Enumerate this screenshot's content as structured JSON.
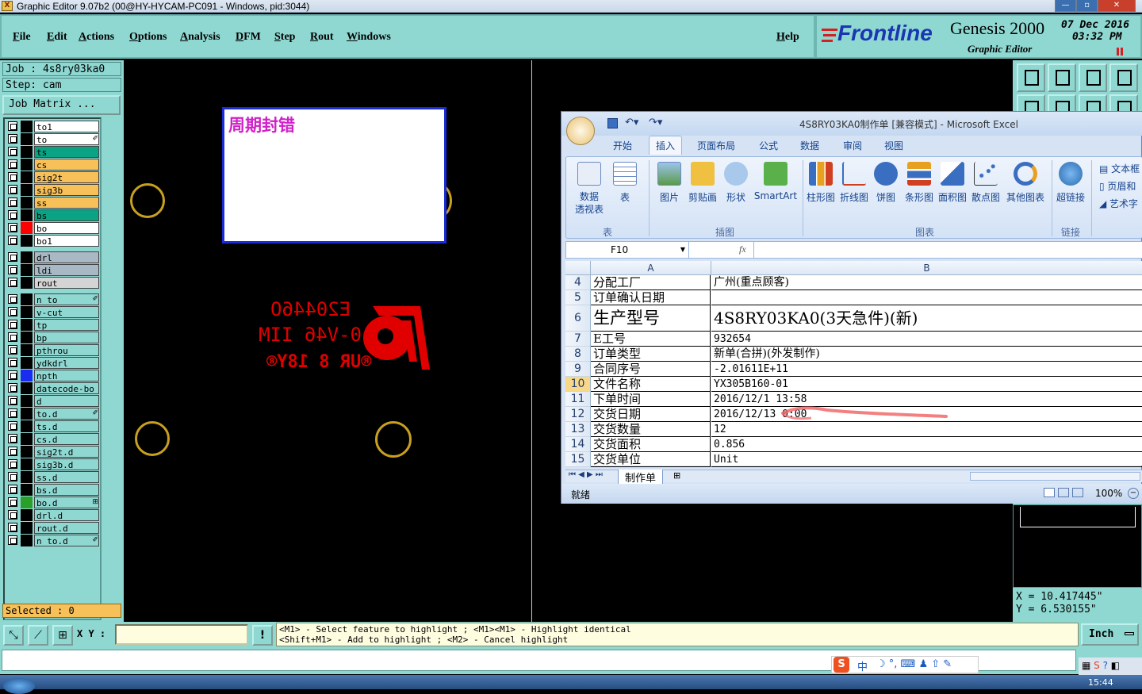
{
  "window": {
    "title": "Graphic Editor 9.07b2 (00@HY-HYCAM-PC091 - Windows, pid:3044)",
    "app_icon_glyph": "X"
  },
  "menu": {
    "items": [
      "File",
      "Edit",
      "Actions",
      "Options",
      "Analysis",
      "DFM",
      "Step",
      "Rout",
      "Windows"
    ],
    "help": "Help"
  },
  "branding": {
    "logo": "Frontline",
    "product": "Genesis 2000",
    "subtitle": "Graphic Editor",
    "date": "07 Dec 2016",
    "time": "03:32 PM"
  },
  "job": {
    "job_label": "Job : 4s8ry03ka0",
    "step_label": "Step: cam",
    "matrix_button": "Job Matrix ..."
  },
  "layers": [
    {
      "name": "to1",
      "bg": "#ffffff",
      "color": "#000000",
      "mark": ""
    },
    {
      "name": "to",
      "bg": "#ffffff",
      "color": "#000000",
      "mark": "✐"
    },
    {
      "name": "ts",
      "bg": "#0aa383",
      "color": "#000000",
      "mark": ""
    },
    {
      "name": "cs",
      "bg": "#f8c058",
      "color": "#000000",
      "mark": ""
    },
    {
      "name": "sig2t",
      "bg": "#f8c058",
      "color": "#000000",
      "mark": ""
    },
    {
      "name": "sig3b",
      "bg": "#f8c058",
      "color": "#000000",
      "mark": ""
    },
    {
      "name": "ss",
      "bg": "#f8c058",
      "color": "#000000",
      "mark": ""
    },
    {
      "name": "bs",
      "bg": "#0aa383",
      "color": "#000000",
      "mark": ""
    },
    {
      "name": "bo",
      "bg": "#ffffff",
      "color": "#ff0000",
      "mark": ""
    },
    {
      "name": "bo1",
      "bg": "#ffffff",
      "color": "#000000",
      "mark": ""
    },
    {
      "name": "drl",
      "bg": "#a8b8c4",
      "color": "#000000",
      "mark": ""
    },
    {
      "name": "ldi",
      "bg": "#a8b8c4",
      "color": "#000000",
      "mark": ""
    },
    {
      "name": "rout",
      "bg": "#d4d4d4",
      "color": "#000000",
      "mark": ""
    },
    {
      "name": "n_to",
      "bg": "#8fd8d2",
      "color": "#000000",
      "mark": "✐"
    },
    {
      "name": "v-cut",
      "bg": "#8fd8d2",
      "color": "#000000",
      "mark": ""
    },
    {
      "name": "tp",
      "bg": "#8fd8d2",
      "color": "#000000",
      "mark": ""
    },
    {
      "name": "bp",
      "bg": "#8fd8d2",
      "color": "#000000",
      "mark": ""
    },
    {
      "name": "pthrou",
      "bg": "#8fd8d2",
      "color": "#000000",
      "mark": ""
    },
    {
      "name": "ydkdrl",
      "bg": "#8fd8d2",
      "color": "#000000",
      "mark": ""
    },
    {
      "name": "npth",
      "bg": "#8fd8d2",
      "color": "#1a2cf0",
      "mark": ""
    },
    {
      "name": "datecode-bo",
      "bg": "#8fd8d2",
      "color": "#000000",
      "mark": ""
    },
    {
      "name": "d",
      "bg": "#8fd8d2",
      "color": "#000000",
      "mark": ""
    },
    {
      "name": "to.d",
      "bg": "#8fd8d2",
      "color": "#000000",
      "mark": "✐"
    },
    {
      "name": "ts.d",
      "bg": "#8fd8d2",
      "color": "#000000",
      "mark": ""
    },
    {
      "name": "cs.d",
      "bg": "#8fd8d2",
      "color": "#000000",
      "mark": ""
    },
    {
      "name": "sig2t.d",
      "bg": "#8fd8d2",
      "color": "#000000",
      "mark": ""
    },
    {
      "name": "sig3b.d",
      "bg": "#8fd8d2",
      "color": "#000000",
      "mark": ""
    },
    {
      "name": "ss.d",
      "bg": "#8fd8d2",
      "color": "#000000",
      "mark": ""
    },
    {
      "name": "bs.d",
      "bg": "#8fd8d2",
      "color": "#000000",
      "mark": ""
    },
    {
      "name": "bo.d",
      "bg": "#8fd8d2",
      "color": "#2aa02a",
      "mark": "⊞"
    },
    {
      "name": "drl.d",
      "bg": "#8fd8d2",
      "color": "#000000",
      "mark": ""
    },
    {
      "name": "rout.d",
      "bg": "#8fd8d2",
      "color": "#000000",
      "mark": ""
    },
    {
      "name": "n_to.d",
      "bg": "#8fd8d2",
      "color": "#000000",
      "mark": "✐"
    }
  ],
  "selected_label": "Selected : 0",
  "canvas": {
    "note_text": "周期封错",
    "silk_line1": "E20446O",
    "silk_line2": "0-V46 IIM",
    "silk_line3": "®UR 8 18Y®"
  },
  "coords": {
    "x": "X  =  10.417445\"",
    "y": "Y  =  6.530155\""
  },
  "bottom": {
    "xy_label": "X Y :",
    "input_value": "",
    "warn_glyph": "!",
    "hint_line1": "<M1> - Select feature to highlight ; <M1><M1> - Highlight identical",
    "hint_line2": "<Shift+M1> - Add to highlight ; <M2> - Cancel highlight",
    "units": "Inch"
  },
  "excel": {
    "title": "4S8RY03KA0制作单  [兼容模式] - Microsoft Excel",
    "tabs": [
      "开始",
      "插入",
      "页面布局",
      "公式",
      "数据",
      "审阅",
      "视图"
    ],
    "active_tab": "插入",
    "ribbon": {
      "pivot": "数据\n透视表",
      "table": "表",
      "picture": "图片",
      "clipart": "剪贴画",
      "shapes": "形状",
      "smartart": "SmartArt",
      "column": "柱形图",
      "line": "折线图",
      "pie": "饼图",
      "bar": "条形图",
      "area": "面积图",
      "scatter": "散点图",
      "other": "其他图表",
      "hyperlink": "超链接",
      "textbox": "文本框",
      "header": "页眉和",
      "wordart": "艺术字",
      "group_table": "表",
      "group_illus": "插图",
      "group_chart": "图表",
      "group_link": "链接"
    },
    "name_box": "F10",
    "fx": "fx",
    "col_a": "A",
    "col_b": "B",
    "rows": [
      {
        "n": "4",
        "a": "分配工厂",
        "b": "广州(重点顾客)"
      },
      {
        "n": "5",
        "a": "订单确认日期",
        "b": ""
      },
      {
        "n": "6",
        "a": "生产型号",
        "b": "4S8RY03KA0(3天急件)(新)"
      },
      {
        "n": "7",
        "a": "E工号",
        "b": "932654"
      },
      {
        "n": "8",
        "a": "订单类型",
        "b": "新单(合拼)(外发制作)"
      },
      {
        "n": "9",
        "a": "合同序号",
        "b": "-2.01611E+11"
      },
      {
        "n": "10",
        "a": "文件名称",
        "b": "YX305B160-01"
      },
      {
        "n": "11",
        "a": "下单时间",
        "b": "2016/12/1 13:58"
      },
      {
        "n": "12",
        "a": "交货日期",
        "b": "2016/12/13 0:00"
      },
      {
        "n": "13",
        "a": "交货数量",
        "b": "12"
      },
      {
        "n": "14",
        "a": "交货面积",
        "b": "0.856"
      },
      {
        "n": "15",
        "a": "交货单位",
        "b": "Unit"
      }
    ],
    "sheet_tab": "制作单",
    "status": "就绪",
    "zoom": "100%"
  },
  "taskbar": {
    "ime": "中",
    "clock": "15:44"
  }
}
